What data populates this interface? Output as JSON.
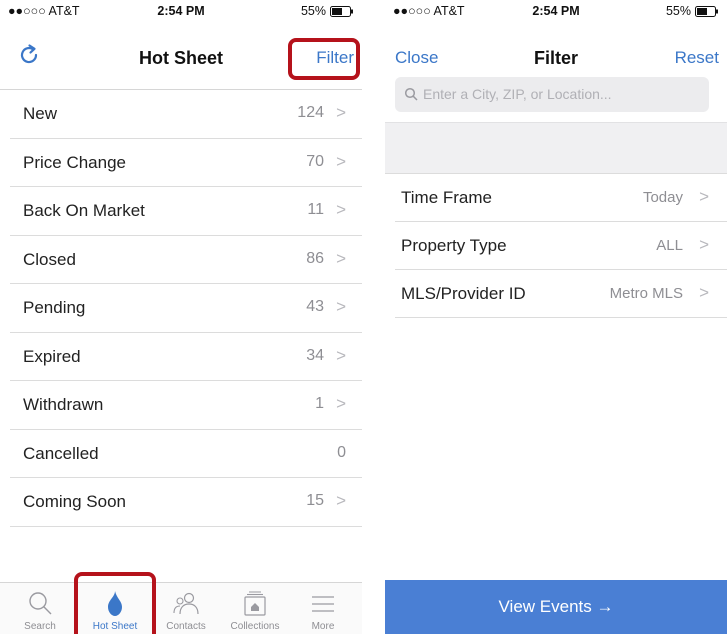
{
  "left": {
    "status": {
      "carrier": "●●○○○ AT&T",
      "time": "2:54 PM",
      "battery": "55%"
    },
    "navbar": {
      "title": "Hot Sheet",
      "filter_label": "Filter"
    },
    "rows": [
      {
        "label": "New",
        "count": "124",
        "chevron": true
      },
      {
        "label": "Price Change",
        "count": "70",
        "chevron": true
      },
      {
        "label": "Back On Market",
        "count": "11",
        "chevron": true
      },
      {
        "label": "Closed",
        "count": "86",
        "chevron": true
      },
      {
        "label": "Pending",
        "count": "43",
        "chevron": true
      },
      {
        "label": "Expired",
        "count": "34",
        "chevron": true
      },
      {
        "label": "Withdrawn",
        "count": "1",
        "chevron": true
      },
      {
        "label": "Cancelled",
        "count": "0",
        "chevron": false
      },
      {
        "label": "Coming Soon",
        "count": "15",
        "chevron": true
      }
    ],
    "tabs": [
      {
        "label": "Search",
        "icon": "search-icon"
      },
      {
        "label": "Hot Sheet",
        "icon": "flame-icon",
        "active": true
      },
      {
        "label": "Contacts",
        "icon": "contacts-icon"
      },
      {
        "label": "Collections",
        "icon": "collections-icon"
      },
      {
        "label": "More",
        "icon": "more-icon"
      }
    ]
  },
  "right": {
    "status": {
      "carrier": "●●○○○ AT&T",
      "time": "2:54 PM",
      "battery": "55%"
    },
    "navbar": {
      "close_label": "Close",
      "title": "Filter",
      "reset_label": "Reset"
    },
    "search": {
      "placeholder": "Enter a City, ZIP, or Location..."
    },
    "filters": [
      {
        "label": "Time Frame",
        "value": "Today"
      },
      {
        "label": "Property Type",
        "value": "ALL"
      },
      {
        "label": "MLS/Provider ID",
        "value": "Metro MLS"
      }
    ],
    "cta_label": "View Events →"
  },
  "colors": {
    "accent": "#3b77c8",
    "highlight": "#b5121b",
    "cta": "#4a7fd4"
  }
}
